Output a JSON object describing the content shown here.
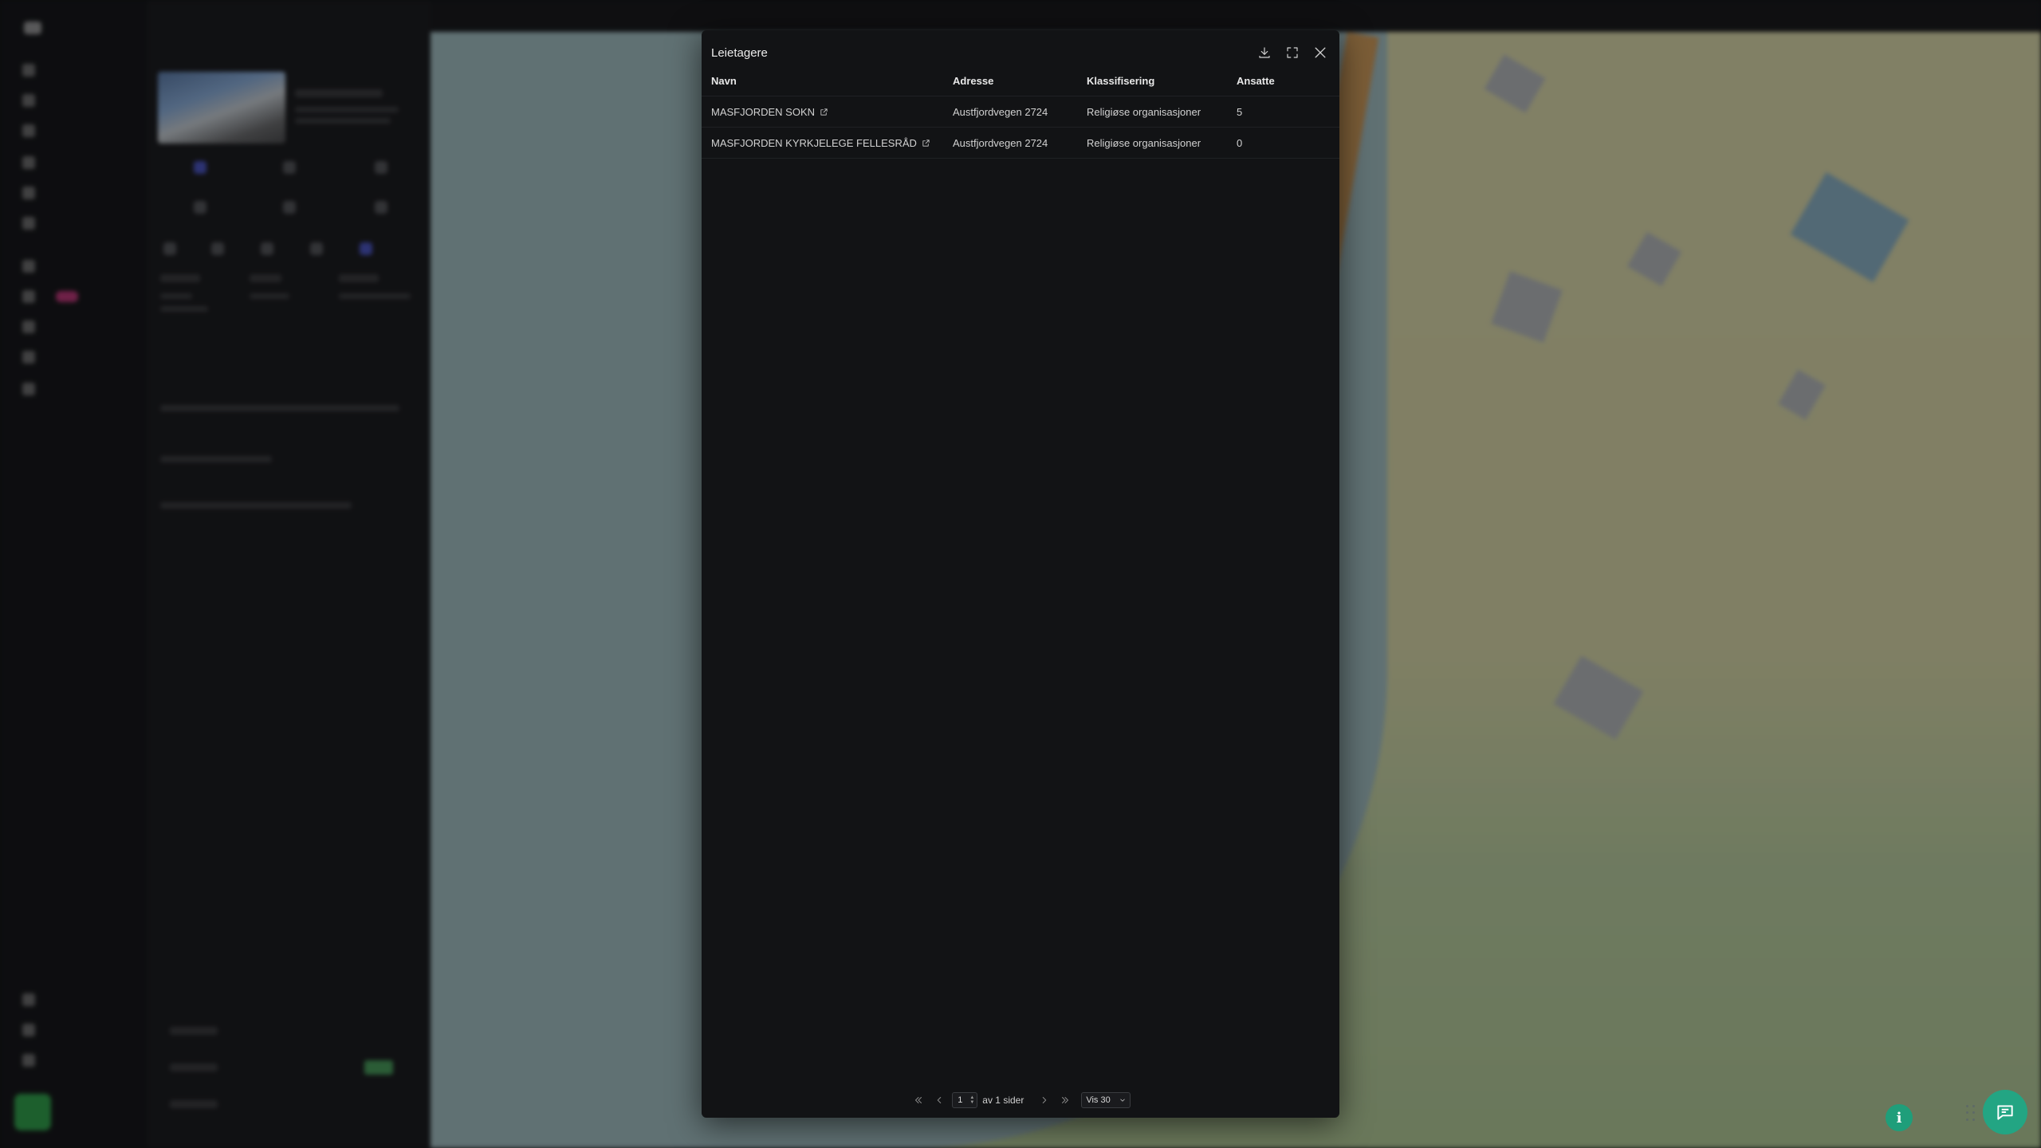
{
  "modal": {
    "title": "Leietagere",
    "download_icon": "download-icon",
    "expand_icon": "expand-icon",
    "close_icon": "close-icon"
  },
  "table": {
    "headers": [
      "Navn",
      "Adresse",
      "Klassifisering",
      "Ansatte"
    ],
    "rows": [
      {
        "navn": "MASFJORDEN SOKN",
        "adresse": "Austfjordvegen 2724",
        "klassifisering": "Religiøse organisasjoner",
        "ansatte": "5"
      },
      {
        "navn": "MASFJORDEN KYRKJELEGE FELLESRÅD",
        "adresse": "Austfjordvegen 2724",
        "klassifisering": "Religiøse organisasjoner",
        "ansatte": "0"
      }
    ],
    "external_link_icon": "external-link-icon"
  },
  "pagination": {
    "current_page": "1",
    "of_pages_text": "av 1 sider",
    "page_size_label": "Vis 30"
  },
  "floating": {
    "info_label": "i",
    "chat_icon": "chat-icon"
  },
  "colors": {
    "accent": "#23a583",
    "modal_bg": "#121315"
  }
}
